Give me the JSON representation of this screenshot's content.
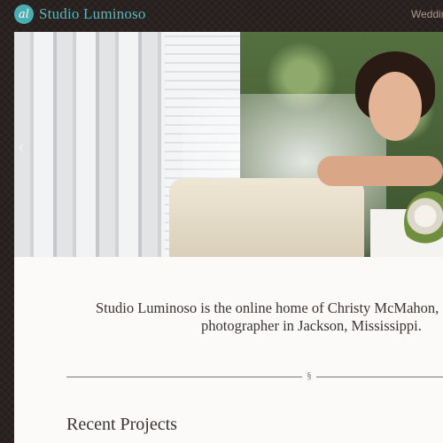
{
  "header": {
    "logo_mark": "al",
    "site_title": "Studio Luminoso",
    "nav_item": "Weddin"
  },
  "hero": {
    "prev_arrow": "‹"
  },
  "intro": {
    "line1": "Studio Luminoso is the online home of Christy McMahon,",
    "line2": "photographer in Jackson, Mississippi."
  },
  "divider": {
    "symbol": "§"
  },
  "sections": {
    "recent_projects": "Recent Projects"
  },
  "colors": {
    "background": "#2a2220",
    "accent": "#56b9bf",
    "content_bg": "#fbfaf8"
  }
}
